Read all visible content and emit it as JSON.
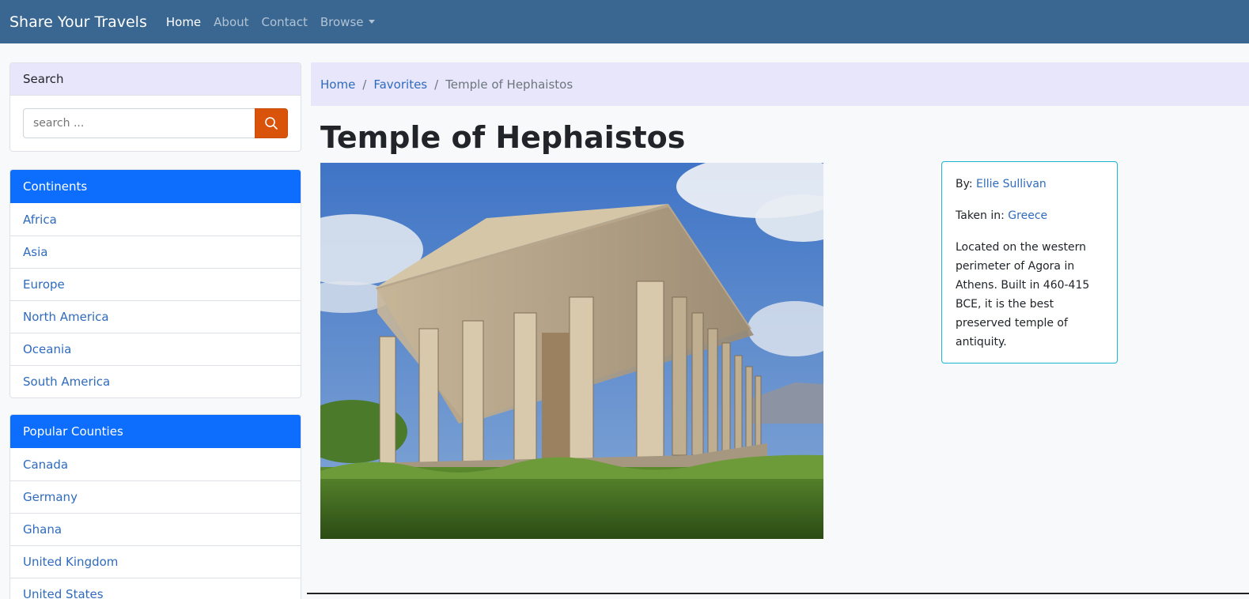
{
  "navbar": {
    "brand": "Share Your Travels",
    "links": [
      "Home",
      "About",
      "Contact",
      "Browse"
    ]
  },
  "search": {
    "header": "Search",
    "placeholder": "search ...",
    "icon": "search-icon",
    "button_color": "#d9540a"
  },
  "continents": {
    "header": "Continents",
    "items": [
      "Africa",
      "Asia",
      "Europe",
      "North America",
      "Oceania",
      "South America"
    ]
  },
  "countries": {
    "header": "Popular Counties",
    "items": [
      "Canada",
      "Germany",
      "Ghana",
      "United Kingdom",
      "United States"
    ]
  },
  "breadcrumb": {
    "items": [
      "Home",
      "Favorites"
    ],
    "separator": "/",
    "current": "Temple of Hephaistos"
  },
  "photo": {
    "title": "Temple of Hephaistos"
  },
  "info": {
    "by_label": "By:",
    "author": "Ellie Sullivan",
    "taken_label": "Taken in:",
    "country": "Greece",
    "description": "Located on the western perimeter of Agora in Athens. Built in 460-415 BCE, it is the best preserved temple of antiquity."
  },
  "colors": {
    "navbar": "#3a6791",
    "primary": "#0d6efd",
    "link": "#2f6bbd",
    "info_border": "#17b8d1"
  }
}
